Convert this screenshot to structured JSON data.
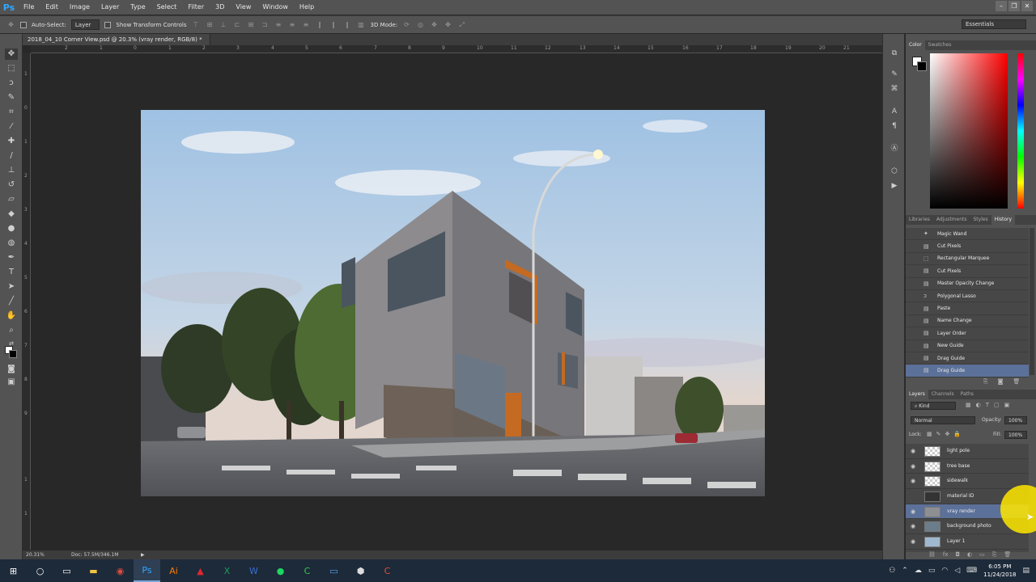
{
  "app": {
    "logo": "Ps"
  },
  "menu": [
    "File",
    "Edit",
    "Image",
    "Layer",
    "Type",
    "Select",
    "Filter",
    "3D",
    "View",
    "Window",
    "Help"
  ],
  "window_controls": {
    "minimize": "–",
    "restore": "❐",
    "close": "✕"
  },
  "options_bar": {
    "auto_select_label": "Auto-Select:",
    "auto_select_value": "Layer",
    "show_transform_label": "Show Transform Controls",
    "mode_3d_label": "3D Mode:",
    "workspace": "Essentials"
  },
  "document": {
    "tab_title": "2018_04_10 Corner View.psd @ 20.3% (vray render, RGB/8) *",
    "tab_close": "×"
  },
  "rulers": {
    "top_ticks": [
      "2",
      "1",
      "0",
      "1",
      "2",
      "3",
      "4",
      "5",
      "6",
      "7",
      "8",
      "9",
      "10",
      "11",
      "12",
      "13",
      "14",
      "15",
      "16",
      "17",
      "18",
      "19",
      "20",
      "21"
    ],
    "left_ticks": [
      "1",
      "0",
      "1",
      "2",
      "3",
      "4",
      "5",
      "6",
      "7",
      "8",
      "9",
      "1",
      "1"
    ]
  },
  "status": {
    "zoom": "20.31%",
    "doc_size": "Doc: 57.5M/346.1M"
  },
  "color_panel": {
    "tabs": [
      "Color",
      "Swatches"
    ],
    "active": "Color"
  },
  "history_panel": {
    "tabs": [
      "Libraries",
      "Adjustments",
      "Styles",
      "History"
    ],
    "active": "History",
    "items": [
      {
        "label": "Magic Wand",
        "icon": "magic-wand-icon"
      },
      {
        "label": "Cut Pixels",
        "icon": "history-step-icon"
      },
      {
        "label": "Rectangular Marquee",
        "icon": "marquee-icon"
      },
      {
        "label": "Cut Pixels",
        "icon": "history-step-icon"
      },
      {
        "label": "Master Opacity Change",
        "icon": "history-step-icon"
      },
      {
        "label": "Polygonal Lasso",
        "icon": "lasso-icon"
      },
      {
        "label": "Paste",
        "icon": "history-step-icon"
      },
      {
        "label": "Name Change",
        "icon": "history-step-icon"
      },
      {
        "label": "Layer Order",
        "icon": "history-step-icon"
      },
      {
        "label": "New Guide",
        "icon": "history-step-icon"
      },
      {
        "label": "Drag Guide",
        "icon": "history-step-icon"
      },
      {
        "label": "Drag Guide",
        "icon": "history-step-icon"
      }
    ],
    "selected_index": 11
  },
  "layers_panel": {
    "tabs": [
      "Layers",
      "Channels",
      "Paths"
    ],
    "active": "Layers",
    "filter_kind": "Kind",
    "blend_mode": "Normal",
    "opacity_label": "Opacity:",
    "opacity_value": "100%",
    "lock_label": "Lock:",
    "fill_label": "Fill:",
    "fill_value": "100%",
    "layers": [
      {
        "name": "light pole",
        "visible": true
      },
      {
        "name": "tree base",
        "visible": true
      },
      {
        "name": "sidewalk",
        "visible": true
      },
      {
        "name": "material ID",
        "visible": false
      },
      {
        "name": "vray render",
        "visible": true
      },
      {
        "name": "background photo",
        "visible": true
      },
      {
        "name": "Layer 1",
        "visible": true
      }
    ],
    "selected_index": 4
  },
  "taskbar": {
    "time": "6:05 PM",
    "date": "11/24/2018"
  }
}
